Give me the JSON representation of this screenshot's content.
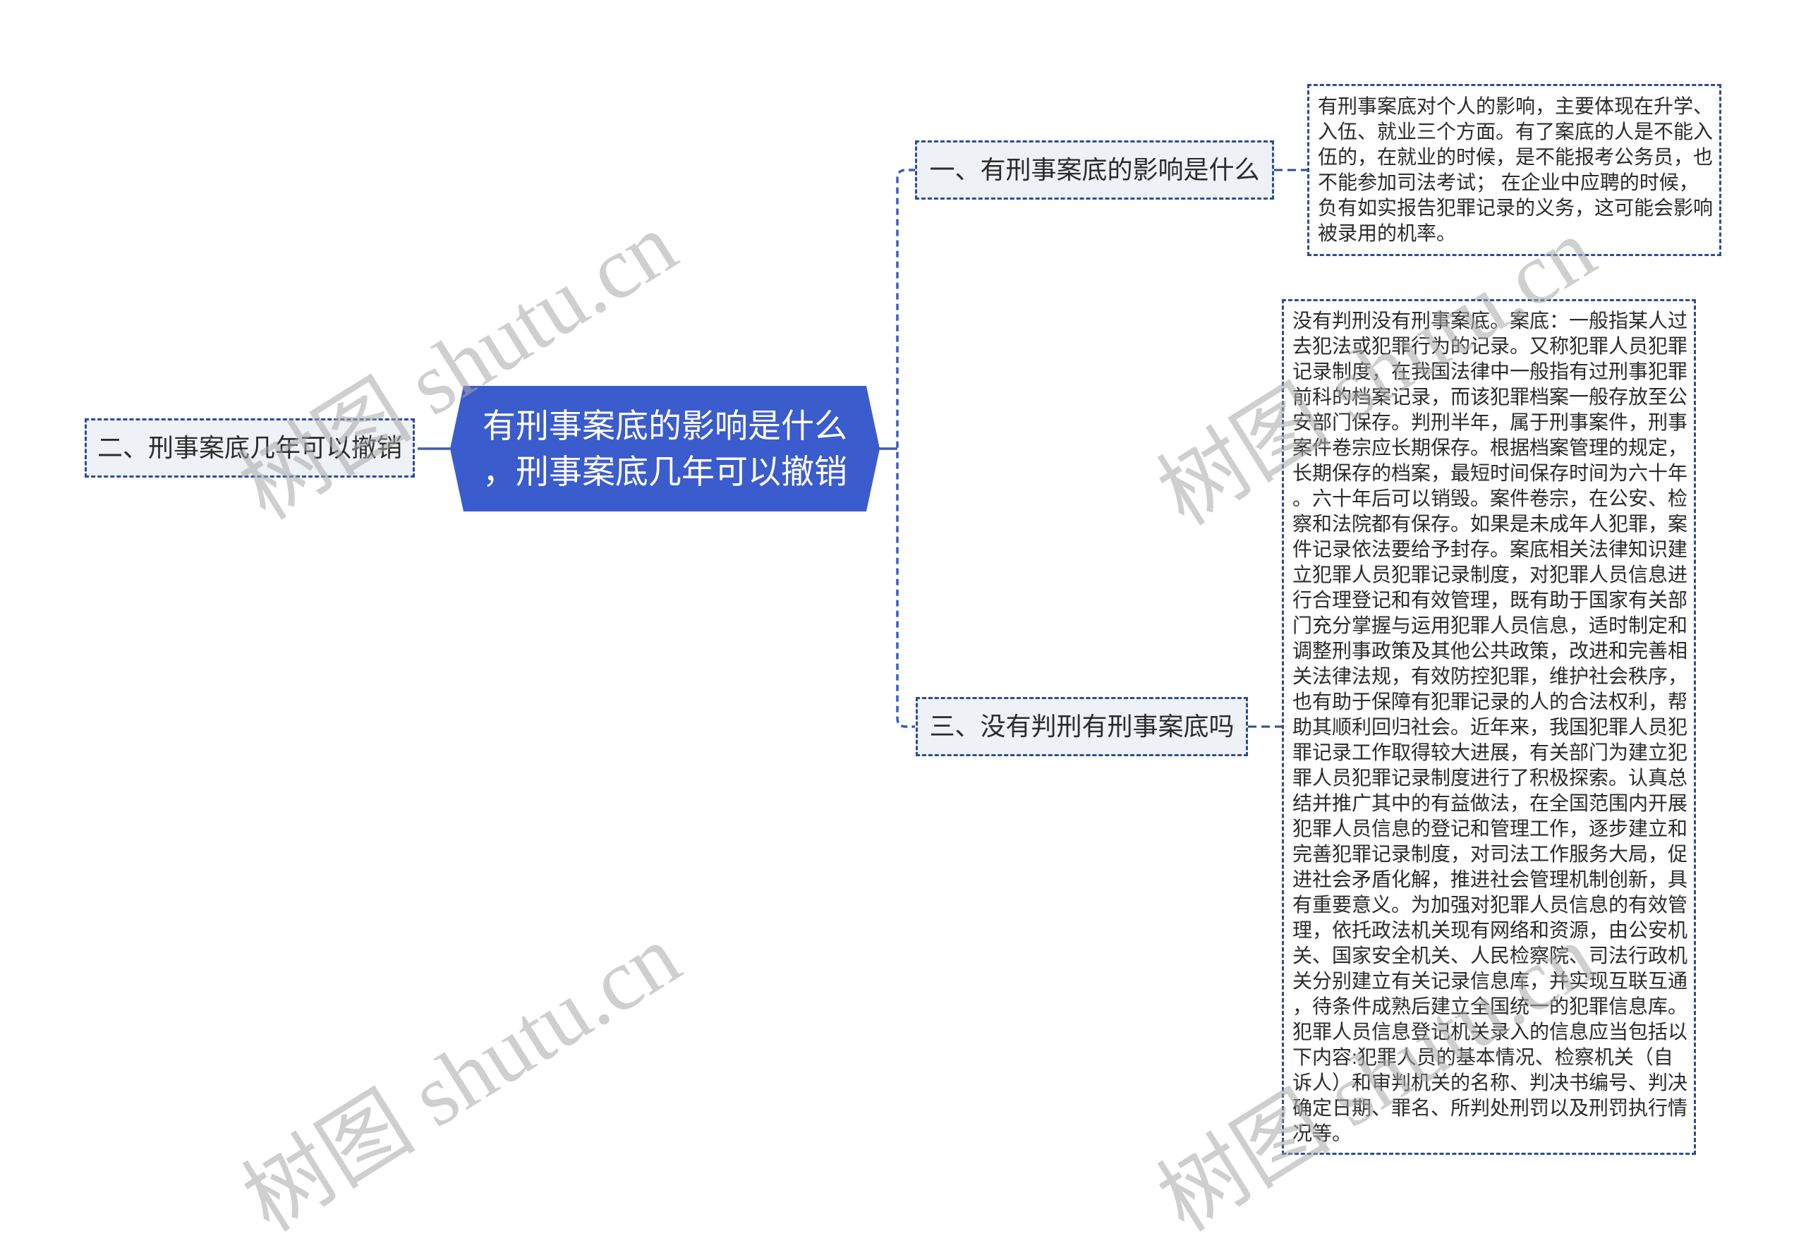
{
  "theme": {
    "accent": "#3b5ccc",
    "connector": "#3b5cc6",
    "node-border": "#2d4d93",
    "node-fill": "#eef1f6",
    "text": "#2b2b2b",
    "watermark": "#a8a8a8",
    "page-bg": "#ffffff"
  },
  "watermark": {
    "text": "树图 shutu.cn"
  },
  "central": {
    "title_lines": [
      "有刑事案底的影响是什么",
      "，刑事案底几年可以撤销"
    ]
  },
  "branches": {
    "one": {
      "label": "一、有刑事案底的影响是什么",
      "detail_lines": [
        "有刑事案底对个人的影响，主要体现在升学、",
        "入伍、就业三个方面。有了案底的人是不能入",
        "伍的，在就业的时候，是不能报考公务员，也",
        "不能参加司法考试； 在企业中应聘的时候，",
        "负有如实报告犯罪记录的义务，这可能会影响",
        "被录用的机率。"
      ]
    },
    "two": {
      "label": "二、刑事案底几年可以撤销"
    },
    "three": {
      "label": "三、没有判刑有刑事案底吗",
      "detail_lines": [
        "没有判刑没有刑事案底。案底：一般指某人过",
        "去犯法或犯罪行为的记录。又称犯罪人员犯罪",
        "记录制度，在我国法律中一般指有过刑事犯罪",
        "前科的档案记录，而该犯罪档案一般存放至公",
        "安部门保存。判刑半年，属于刑事案件，刑事",
        "案件卷宗应长期保存。根据档案管理的规定，",
        "长期保存的档案，最短时间保存时间为六十年",
        "。六十年后可以销毁。案件卷宗，在公安、检",
        "察和法院都有保存。如果是未成年人犯罪，案",
        "件记录依法要给予封存。案底相关法律知识建",
        "立犯罪人员犯罪记录制度，对犯罪人员信息进",
        "行合理登记和有效管理，既有助于国家有关部",
        "门充分掌握与运用犯罪人员信息，适时制定和",
        "调整刑事政策及其他公共政策，改进和完善相",
        "关法律法规，有效防控犯罪，维护社会秩序，",
        "也有助于保障有犯罪记录的人的合法权利，帮",
        "助其顺利回归社会。近年来，我国犯罪人员犯",
        "罪记录工作取得较大进展，有关部门为建立犯",
        "罪人员犯罪记录制度进行了积极探索。认真总",
        "结并推广其中的有益做法，在全国范围内开展",
        "犯罪人员信息的登记和管理工作，逐步建立和",
        "完善犯罪记录制度，对司法工作服务大局，促",
        "进社会矛盾化解，推进社会管理机制创新，具",
        "有重要意义。为加强对犯罪人员信息的有效管",
        "理，依托政法机关现有网络和资源，由公安机",
        "关、国家安全机关、人民检察院、司法行政机",
        "关分别建立有关记录信息库，并实现互联互通",
        "，待条件成熟后建立全国统一的犯罪信息库。",
        "犯罪人员信息登记机关录入的信息应当包括以",
        "下内容:犯罪人员的基本情况、检察机关（自",
        "诉人）和审判机关的名称、判决书编号、判决",
        "确定日期、罪名、所判处刑罚以及刑罚执行情",
        "况等。"
      ]
    }
  }
}
